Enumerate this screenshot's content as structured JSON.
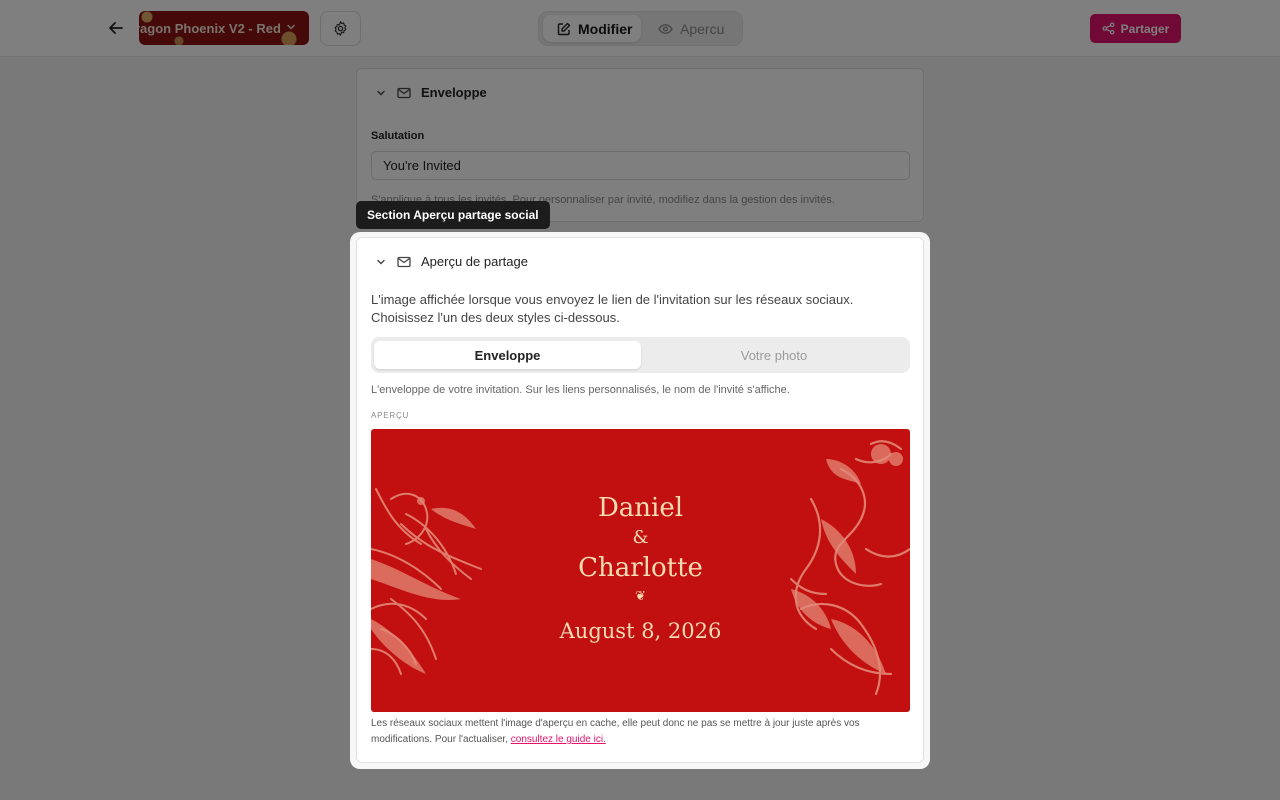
{
  "header": {
    "theme_name": "ragon Phoenix V2 - Red",
    "mode_edit": "Modifier",
    "mode_preview": "Apercu",
    "share": "Partager"
  },
  "envelope_section": {
    "title": "Enveloppe",
    "salutation_label": "Salutation",
    "salutation_value": "You're Invited",
    "help": "S'applique à tous les invités. Pour personnaliser par invité, modifiez dans la gestion des invités."
  },
  "tooltip": "Section Aperçu partage social",
  "share_section": {
    "title": "Aperçu de partage",
    "description": "L'image affichée lorsque vous envoyez le lien de l'invitation sur les réseaux sociaux. Choisissez l'un des deux styles ci-dessous.",
    "options": [
      "Enveloppe",
      "Votre photo"
    ],
    "selected": "Enveloppe",
    "option_help": "L'enveloppe de votre invitation. Sur les liens personnalisés, le nom de l'invité s'affiche.",
    "preview_caption": "APERÇU",
    "preview": {
      "name1": "Daniel",
      "ampersand": "&",
      "name2": "Charlotte",
      "ornament": "❦",
      "date": "August 8, 2026"
    },
    "footer_text": "Les réseaux sociaux mettent l'image d'aperçu en cache, elle peut donc ne pas se mettre à jour juste après vos modifications. Pour l'actualiser,",
    "footer_link": "consultez le guide ici."
  },
  "colors": {
    "accent": "#e3136e",
    "preview_background": "#c20f0f",
    "preview_text": "#f6dcb3"
  },
  "icons": {
    "back": "arrow-left-icon",
    "settings": "gear-icon",
    "edit": "edit-icon",
    "preview": "eye-icon",
    "share": "share-icon",
    "mail": "mail-icon",
    "chevron": "chevron-down-icon"
  }
}
